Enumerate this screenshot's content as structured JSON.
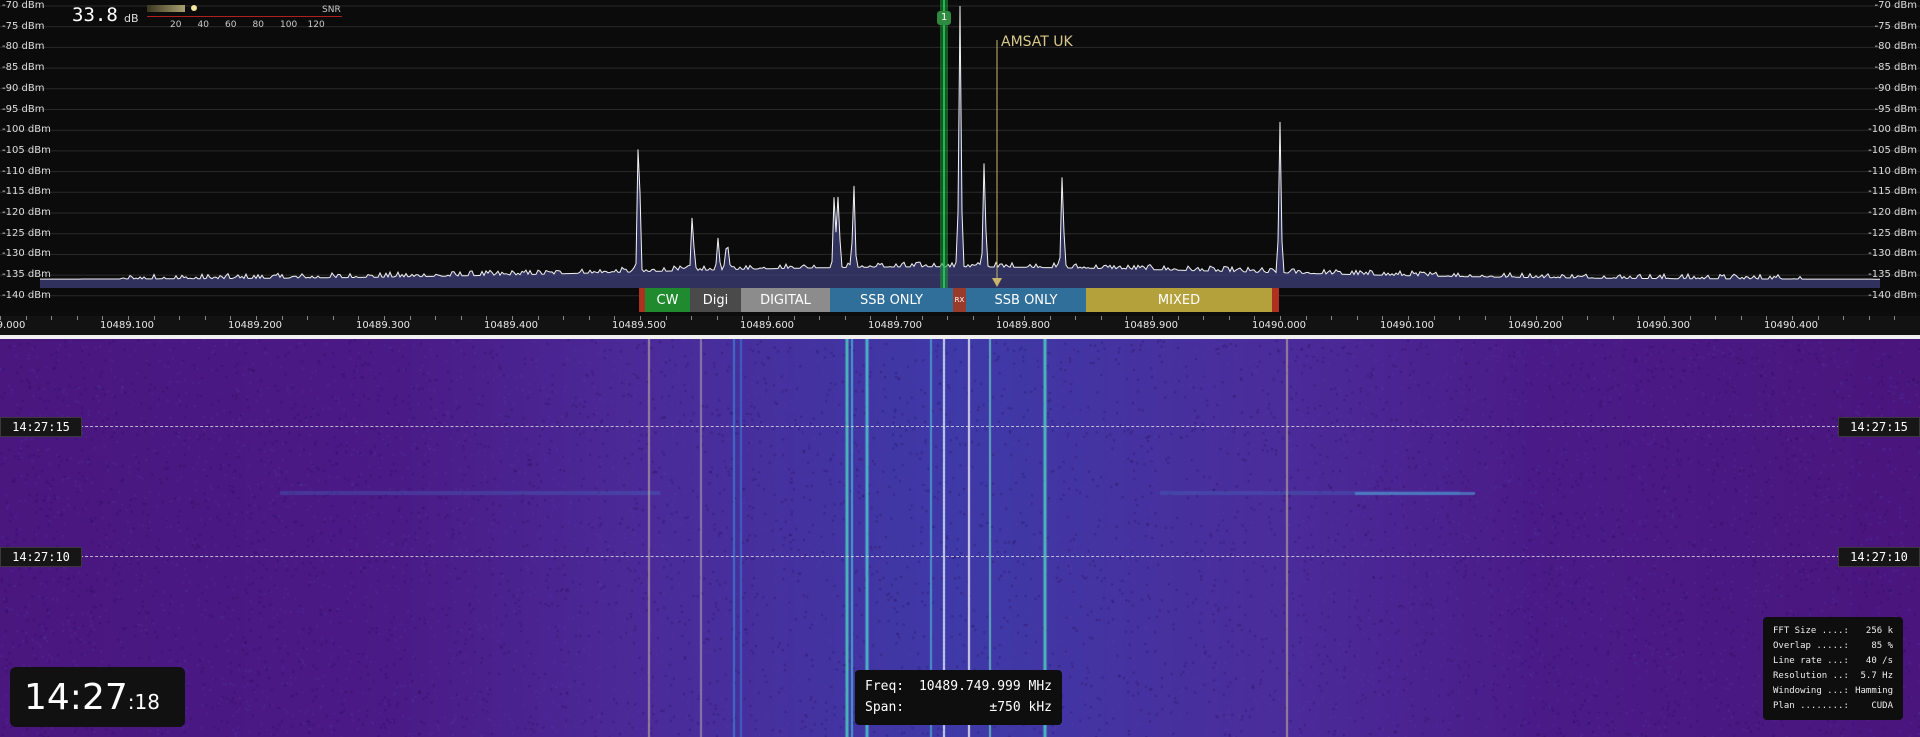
{
  "snr": {
    "value": "33.8",
    "unit": "dB",
    "label": "SNR",
    "ticks": [
      "20",
      "40",
      "60",
      "80",
      "100",
      "120"
    ],
    "level": 33.8
  },
  "dbm_labels": [
    "-70 dBm",
    "-75 dBm",
    "-80 dBm",
    "-85 dBm",
    "-90 dBm",
    "-95 dBm",
    "-100 dBm",
    "-105 dBm",
    "-110 dBm",
    "-115 dBm",
    "-120 dBm",
    "-125 dBm",
    "-130 dBm",
    "-135 dBm",
    "-140 dBm"
  ],
  "freq_ticks": [
    "9.000",
    "10489.100",
    "10489.200",
    "10489.300",
    "10489.400",
    "10489.500",
    "10489.600",
    "10489.700",
    "10489.800",
    "10489.900",
    "10490.000",
    "10490.100",
    "10490.200",
    "10490.300",
    "10490.400"
  ],
  "bands": [
    {
      "label": "",
      "color": "#b03020"
    },
    {
      "label": "CW",
      "color": "#1f8a2e"
    },
    {
      "label": "Digi",
      "color": "#4a4a4a"
    },
    {
      "label": "DIGITAL",
      "color": "#8c8c8c"
    },
    {
      "label": "SSB ONLY",
      "color": "#2f6f9a"
    },
    {
      "label": "RX",
      "color": "#9a3a2a"
    },
    {
      "label": "SSB ONLY",
      "color": "#2f6f9a"
    },
    {
      "label": "MIXED",
      "color": "#b5a13c"
    },
    {
      "label": "",
      "color": "#b03020"
    }
  ],
  "marker": {
    "label": "AMSAT UK",
    "channel": "1"
  },
  "time_marks": [
    "14:27:15",
    "14:27:10"
  ],
  "clock": {
    "hm": "14:27",
    "s": ":18"
  },
  "freq_info": {
    "freq_label": "Freq:",
    "freq_value": "10489.749.999 MHz",
    "span_label": "Span:",
    "span_value": "±750 kHz"
  },
  "fft_info": [
    {
      "k": "FFT Size ....:",
      "v": "256 k"
    },
    {
      "k": "Overlap .....:",
      "v": "85 %"
    },
    {
      "k": "Line rate ...:",
      "v": "40 /s"
    },
    {
      "k": "Resolution ..:",
      "v": "5.7 Hz"
    },
    {
      "k": "Windowing ...:",
      "v": "Hamming"
    },
    {
      "k": "Plan ........:",
      "v": "CUDA"
    }
  ],
  "spectrum_peaks": [
    {
      "f": 10489.499,
      "db": -98
    },
    {
      "f": 10489.541,
      "db": -120
    },
    {
      "f": 10489.561,
      "db": -126
    },
    {
      "f": 10489.568,
      "db": -126
    },
    {
      "f": 10489.652,
      "db": -114
    },
    {
      "f": 10489.655,
      "db": -115
    },
    {
      "f": 10489.667,
      "db": -113
    },
    {
      "f": 10489.75,
      "db": -70
    },
    {
      "f": 10489.769,
      "db": -107
    },
    {
      "f": 10489.83,
      "db": -110
    },
    {
      "f": 10490.0,
      "db": -98
    }
  ]
}
